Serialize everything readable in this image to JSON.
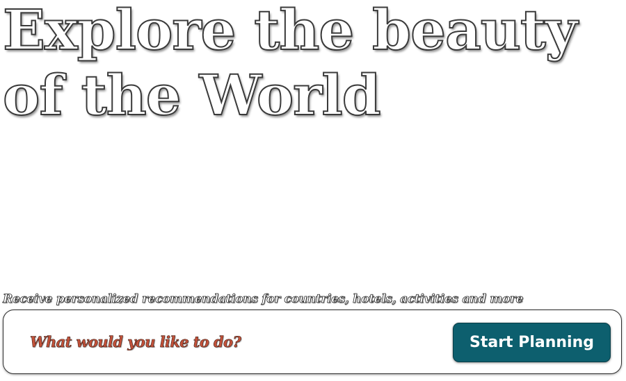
{
  "hero": {
    "title": "Explore the beauty of the World",
    "subtitle": "Receive personalized recommendations for countries, hotels, activities and more"
  },
  "search": {
    "placeholder": "What would you like to do?",
    "value": ""
  },
  "actions": {
    "start_label": "Start Planning"
  },
  "colors": {
    "button_background": "#0d5f6e",
    "placeholder_text": "#c4523a",
    "background": "#ffffff"
  }
}
